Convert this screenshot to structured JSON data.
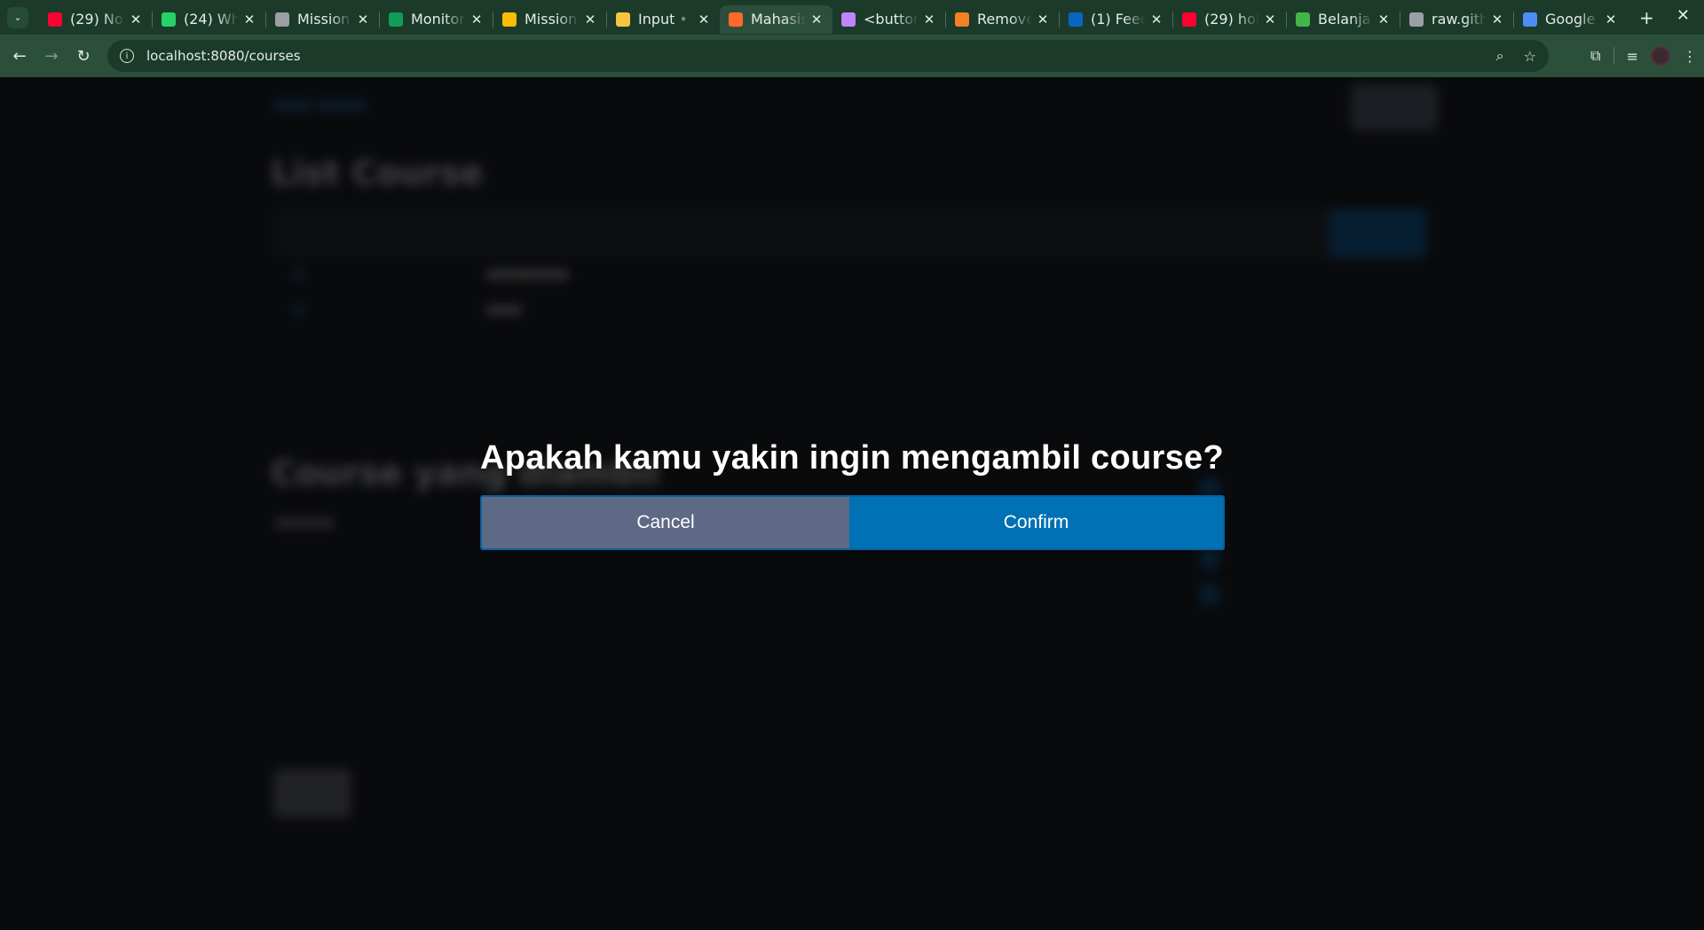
{
  "browser": {
    "tabs": [
      {
        "title": "(29) No",
        "favicon": "youtube-icon",
        "color": "#ff0033",
        "active": false
      },
      {
        "title": "(24) Wh",
        "favicon": "whatsapp-icon",
        "color": "#25d366",
        "active": false
      },
      {
        "title": "Mission",
        "favicon": "image-icon",
        "color": "#9aa0a6",
        "active": false
      },
      {
        "title": "Monitor",
        "favicon": "sheets-icon",
        "color": "#0f9d58",
        "active": false
      },
      {
        "title": "Mission",
        "favicon": "drive-icon",
        "color": "#fbbc04",
        "active": false
      },
      {
        "title": "Input • I",
        "favicon": "sparkle-icon",
        "color": "#f5c542",
        "active": false
      },
      {
        "title": "Mahasis",
        "favicon": "flame-icon",
        "color": "#ff6a2b",
        "active": true
      },
      {
        "title": "<button",
        "favicon": "m-logo-icon",
        "color": "#c084fc",
        "active": false
      },
      {
        "title": "Remove",
        "favicon": "stackoverflow-icon",
        "color": "#f48024",
        "active": false
      },
      {
        "title": "(1) Feed",
        "favicon": "linkedin-icon",
        "color": "#0a66c2",
        "active": false
      },
      {
        "title": "(29) hol",
        "favicon": "youtube-icon",
        "color": "#ff0033",
        "active": false
      },
      {
        "title": "Belanja",
        "favicon": "tokopedia-icon",
        "color": "#42b549",
        "active": false
      },
      {
        "title": "raw.gith",
        "favicon": "globe-icon",
        "color": "#9aa0a6",
        "active": false
      },
      {
        "title": "Google",
        "favicon": "gemini-icon",
        "color": "#4c8df6",
        "active": false
      }
    ],
    "url": "localhost:8080/courses"
  },
  "background_page": {
    "list_heading": "List Course",
    "taken_heading": "Course yang diambil"
  },
  "dialog": {
    "title": "Apakah kamu yakin ingin mengambil course?",
    "cancel_label": "Cancel",
    "confirm_label": "Confirm"
  },
  "colors": {
    "cancel_bg": "#5d6985",
    "confirm_bg": "#0071b4",
    "chrome_bg": "#1b3a2a"
  }
}
